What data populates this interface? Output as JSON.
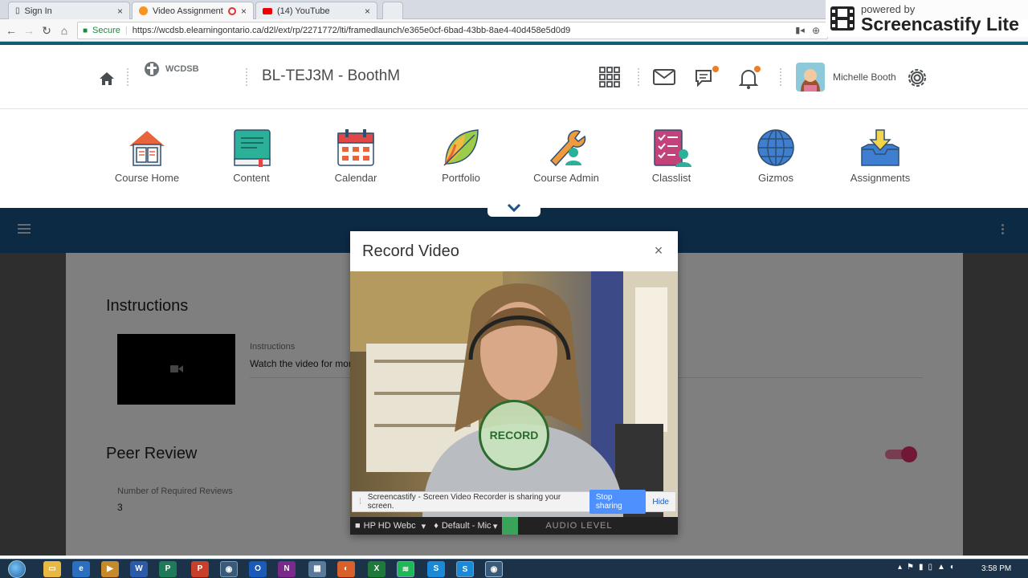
{
  "browser": {
    "tabs": [
      {
        "title": "Sign In",
        "favicon": "document-icon"
      },
      {
        "title": "Video Assignments -",
        "favicon": "brightspace-icon",
        "active": true,
        "recording": true
      },
      {
        "title": "(14) YouTube",
        "favicon": "youtube-icon"
      }
    ],
    "secure_label": "Secure",
    "url": "https://wcdsb.elearningontario.ca/d2l/ext/rp/2271772/lti/framedlaunch/e365e0cf-6bad-43bb-8ae4-40d458e5d0d9"
  },
  "watermark": {
    "powered": "powered by",
    "brand": "Screencastify Lite"
  },
  "header": {
    "org_logo": "WCDSB",
    "course_title": "BL-TEJ3M - BoothM",
    "user_name": "Michelle Booth"
  },
  "nav": [
    {
      "label": "Course Home",
      "icon": "house-book-icon"
    },
    {
      "label": "Content",
      "icon": "book-icon"
    },
    {
      "label": "Calendar",
      "icon": "calendar-icon"
    },
    {
      "label": "Portfolio",
      "icon": "leaf-icon"
    },
    {
      "label": "Course Admin",
      "icon": "wrench-person-icon"
    },
    {
      "label": "Classlist",
      "icon": "checklist-icon"
    },
    {
      "label": "Gizmos",
      "icon": "globe-icon"
    },
    {
      "label": "Assignments",
      "icon": "inbox-arrow-icon"
    }
  ],
  "content": {
    "instructions_title": "Instructions",
    "instructions_label": "Instructions",
    "instructions_text": "Watch the video for more",
    "peer_review_title": "Peer Review",
    "required_reviews_label": "Number of Required Reviews",
    "required_reviews_value": "3",
    "peer_review_enabled": true
  },
  "dialog": {
    "title": "Record Video",
    "close": "×",
    "record_label": "RECORD",
    "camera_select": "HP HD Webc",
    "mic_select": "Default - Mic",
    "audio_level_label": "AUDIO LEVEL"
  },
  "share_bar": {
    "message": "Screencastify - Screen Video Recorder is sharing your screen.",
    "stop_label": "Stop sharing",
    "hide_label": "Hide"
  },
  "taskbar": {
    "clock": "3:58 PM"
  }
}
